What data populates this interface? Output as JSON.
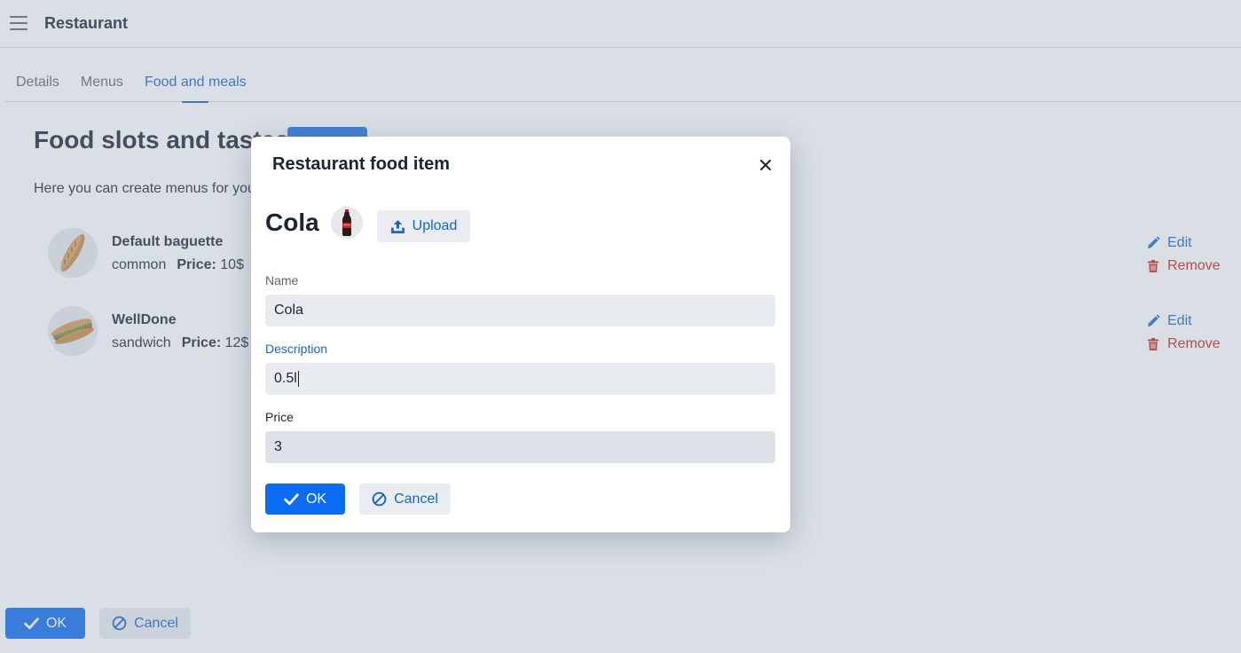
{
  "app": {
    "title": "Restaurant"
  },
  "tabs": [
    {
      "label": "Details",
      "active": false
    },
    {
      "label": "Menus",
      "active": false
    },
    {
      "label": "Food and meals",
      "active": true
    }
  ],
  "section": {
    "title": "Food slots and tastes",
    "description": "Here you can create menus for your restaurant"
  },
  "food_items": [
    {
      "name": "Default baguette",
      "category": "common",
      "price_label": "Price:",
      "price": "10$",
      "image_icon": "baguette-icon"
    },
    {
      "name": "WellDone",
      "category": "sandwich",
      "price_label": "Price:",
      "price": "12$",
      "image_icon": "sandwich-icon"
    }
  ],
  "row_actions": {
    "edit_label": "Edit",
    "remove_label": "Remove"
  },
  "bottom_actions": {
    "ok_label": "OK",
    "cancel_label": "Cancel"
  },
  "dialog": {
    "title": "Restaurant food item",
    "item_name": "Cola",
    "image_icon": "cola-bottle-icon",
    "upload_label": "Upload",
    "fields": {
      "name": {
        "label": "Name",
        "value": "Cola"
      },
      "description": {
        "label": "Description",
        "value": "0.5l"
      },
      "price": {
        "label": "Price",
        "value": "3"
      }
    },
    "ok_label": "OK",
    "cancel_label": "Cancel"
  },
  "colors": {
    "primary": "#0b6bf2",
    "link": "#1465cc",
    "danger": "#c5221f",
    "overlay": "#94a0b4"
  }
}
